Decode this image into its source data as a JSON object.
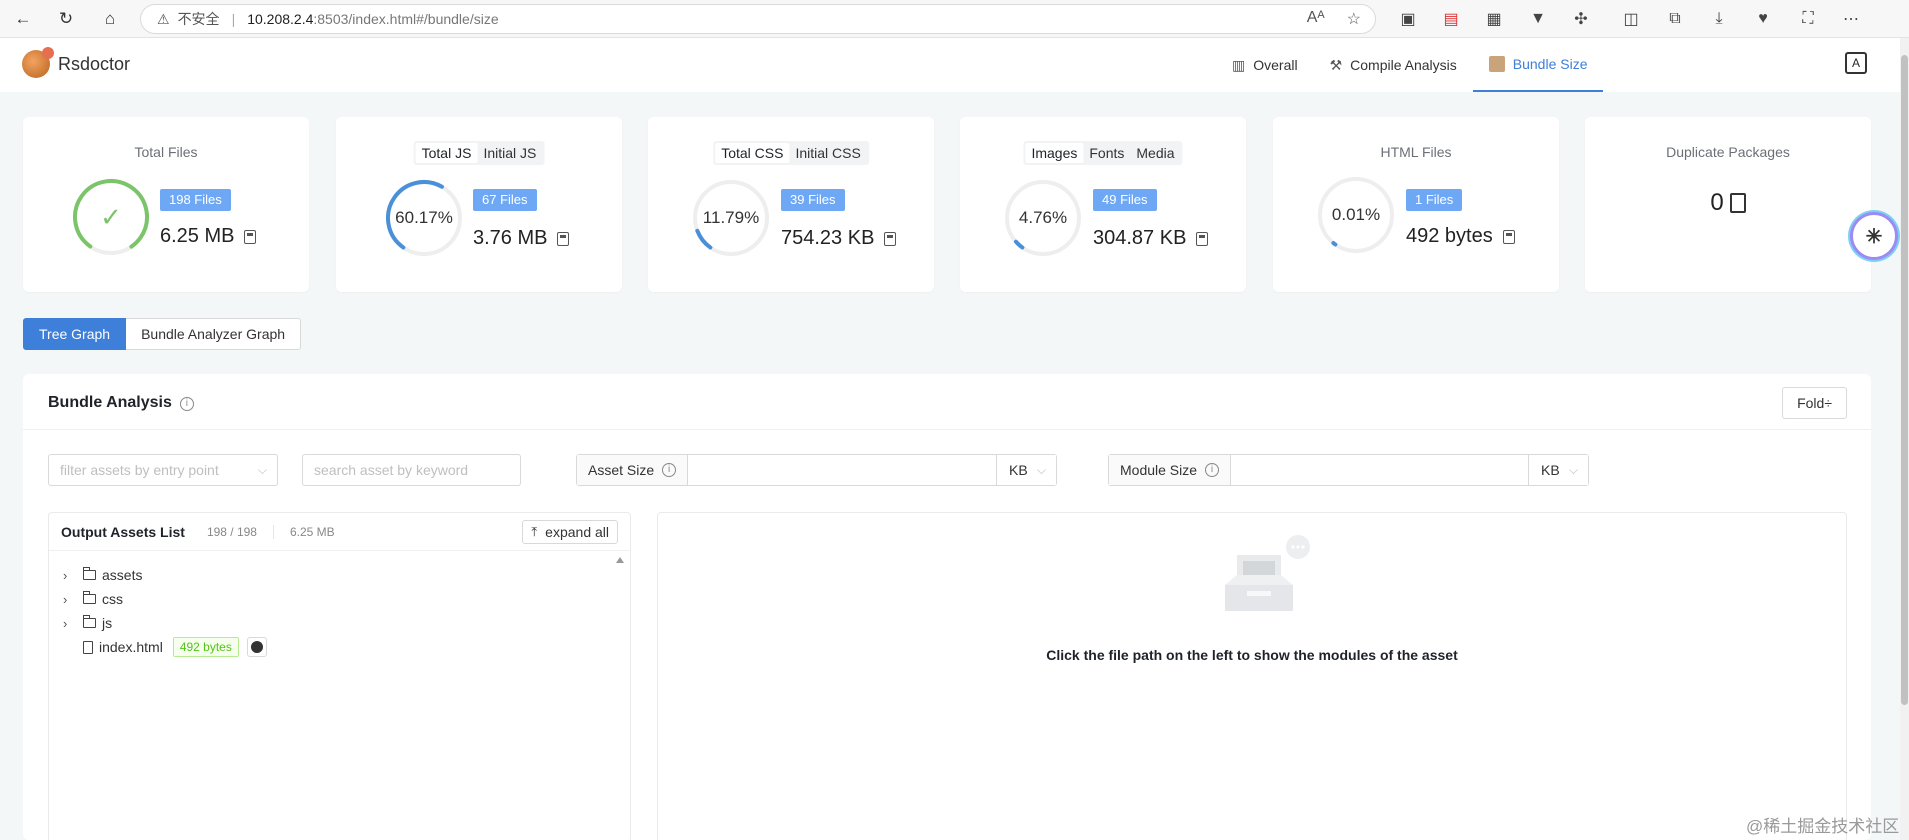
{
  "browser": {
    "insecure_label": "不安全",
    "url_host": "10.208.2.4",
    "url_rest": ":8503/index.html#/bundle/size"
  },
  "app": {
    "name": "Rsdoctor",
    "tabs": [
      {
        "label": "Overall",
        "icon": "bar-chart-icon"
      },
      {
        "label": "Compile Analysis",
        "icon": "wrench-icon"
      },
      {
        "label": "Bundle Size",
        "icon": "package-icon",
        "active": true
      }
    ]
  },
  "cards": {
    "total_files": {
      "title": "Total Files",
      "badge": "198 Files",
      "size": "6.25 MB",
      "progress": 1.0,
      "color": "#7cc46a"
    },
    "js": {
      "seg": [
        "Total JS",
        "Initial JS"
      ],
      "percent": "60.17%",
      "badge": "67 Files",
      "size": "3.76 MB",
      "progress": 0.6017
    },
    "css": {
      "seg": [
        "Total CSS",
        "Initial CSS"
      ],
      "percent": "11.79%",
      "badge": "39 Files",
      "size": "754.23 KB",
      "progress": 0.1179
    },
    "media": {
      "seg": [
        "Images",
        "Fonts",
        "Media"
      ],
      "percent": "4.76%",
      "badge": "49 Files",
      "size": "304.87 KB",
      "progress": 0.0476
    },
    "html": {
      "title": "HTML Files",
      "percent": "0.01%",
      "badge": "1 Files",
      "size": "492 bytes",
      "progress": 0.0001
    },
    "dup": {
      "title": "Duplicate Packages",
      "value": "0"
    }
  },
  "graph_toggle": {
    "tree": "Tree Graph",
    "analyzer": "Bundle Analyzer Graph"
  },
  "panel": {
    "title": "Bundle Analysis",
    "fold_label": "Fold",
    "filter_placeholder": "filter assets by entry point",
    "search_placeholder": "search asset by keyword",
    "asset_size_label": "Asset Size",
    "module_size_label": "Module Size",
    "unit": "KB"
  },
  "assets": {
    "title": "Output Assets List",
    "count": "198 / 198",
    "total_size": "6.25 MB",
    "expand_label": "expand all",
    "folders": [
      "assets",
      "css",
      "js"
    ],
    "file": {
      "name": "index.html",
      "size": "492 bytes"
    }
  },
  "detail": {
    "empty_text": "Click the file path on the left to show the modules of the asset"
  },
  "watermark": "@稀土掘金技术社区",
  "colors": {
    "accent": "#3d7fd9",
    "badge": "#6ea8f5"
  }
}
